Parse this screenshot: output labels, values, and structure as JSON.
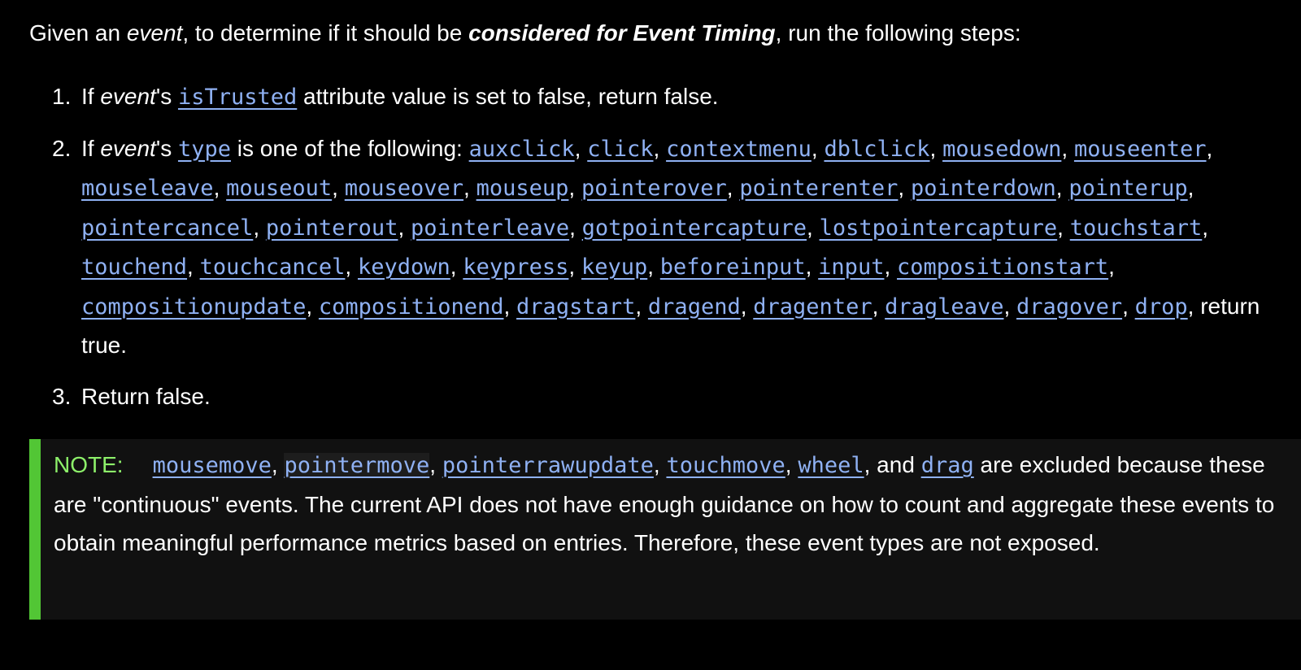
{
  "intro": {
    "part1": "Given an ",
    "event_word": "event",
    "part2": ", to determine if it should be ",
    "strong_phrase": "considered for Event Timing",
    "part3": ", run the following steps:"
  },
  "steps": [
    {
      "number": "1.",
      "if": "If ",
      "event_word": "event",
      "possessive": "'s ",
      "term": "isTrusted",
      "rest": " attribute value is set to false, return false."
    },
    {
      "number": "2.",
      "if": "If ",
      "event_word": "event",
      "possessive": "'s ",
      "term": "type",
      "middle": " is one of the following: ",
      "event_types": [
        "auxclick",
        "click",
        "contextmenu",
        "dblclick",
        "mousedown",
        "mouseenter",
        "mouseleave",
        "mouseout",
        "mouseover",
        "mouseup",
        "pointerover",
        "pointerenter",
        "pointerdown",
        "pointerup",
        "pointercancel",
        "pointerout",
        "pointerleave",
        "gotpointercapture",
        "lostpointercapture",
        "touchstart",
        "touchend",
        "touchcancel",
        "keydown",
        "keypress",
        "keyup",
        "beforeinput",
        "input",
        "compositionstart",
        "compositionupdate",
        "compositionend",
        "dragstart",
        "dragend",
        "dragenter",
        "dragleave",
        "dragover",
        "drop"
      ],
      "end": ", return true."
    },
    {
      "number": "3.",
      "text": "Return false."
    }
  ],
  "note": {
    "label": "NOTE:",
    "terms": [
      "mousemove",
      "pointermove",
      "pointerrawupdate",
      "touchmove",
      "wheel"
    ],
    "and_text": ", and ",
    "last_term": "drag",
    "body": " are excluded because these are \"continuous\" events. The current API does not have enough guidance on how to count and aggregate these events to obtain meaningful performance metrics based on entries. Therefore, these event types are not exposed."
  },
  "colors": {
    "background": "#000000",
    "text": "#ffffff",
    "link": "#8fb1f3",
    "note_background": "#111111",
    "note_border": "#52c635",
    "note_label": "#8df06a"
  }
}
